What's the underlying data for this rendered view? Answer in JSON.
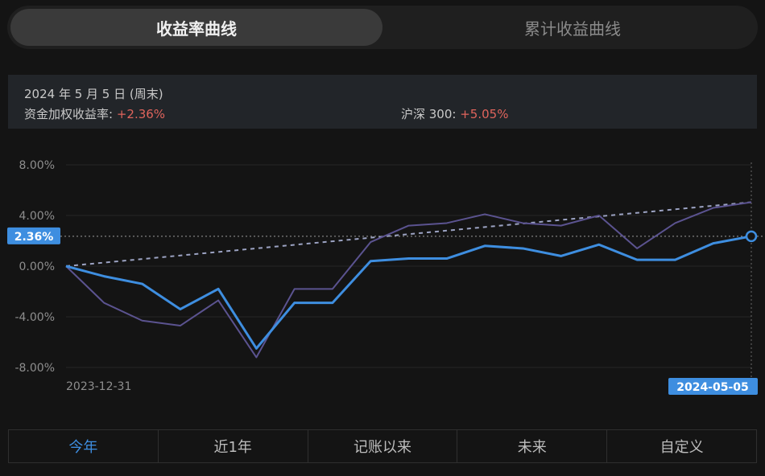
{
  "tabs": [
    {
      "label": "收益率曲线",
      "active": true
    },
    {
      "label": "累计收益曲线",
      "active": false
    }
  ],
  "info": {
    "date": "2024 年 5 月 5 日 (周末)",
    "fund_label": "资金加权收益率:",
    "fund_value": "+2.36%",
    "index_label": "沪深 300:",
    "index_value": "+5.05%"
  },
  "colors": {
    "primary": "#3e8ee0",
    "secondary": "#5b5390",
    "positive": "#e0645c"
  },
  "chart_data": {
    "type": "line",
    "x": [
      "2023-12-31",
      "2024-01-07",
      "2024-01-14",
      "2024-01-21",
      "2024-01-28",
      "2024-02-04",
      "2024-02-11",
      "2024-02-18",
      "2024-02-25",
      "2024-03-03",
      "2024-03-10",
      "2024-03-17",
      "2024-03-24",
      "2024-03-31",
      "2024-04-07",
      "2024-04-14",
      "2024-04-21",
      "2024-04-28",
      "2024-05-05"
    ],
    "series": [
      {
        "name": "资金加权收益率",
        "values": [
          0.0,
          -0.8,
          -1.4,
          -3.4,
          -1.8,
          -6.5,
          -2.9,
          -2.9,
          0.4,
          0.6,
          0.6,
          1.6,
          1.4,
          0.8,
          1.7,
          0.5,
          0.5,
          1.8,
          2.36
        ],
        "color": "#3e8ee0"
      },
      {
        "name": "沪深 300",
        "values": [
          0.0,
          -2.9,
          -4.3,
          -4.7,
          -2.7,
          -7.2,
          -1.8,
          -1.8,
          1.9,
          3.2,
          3.4,
          4.1,
          3.4,
          3.2,
          4.0,
          1.4,
          3.4,
          4.6,
          5.05
        ],
        "color": "#5b5390"
      }
    ],
    "trend": {
      "from": 0.0,
      "to": 5.05
    },
    "yticks": [
      "8.00%",
      "4.00%",
      "0.00%",
      "-4.00%",
      "-8.00%"
    ],
    "ytick_values": [
      8,
      4,
      0,
      -4,
      -8
    ],
    "ylim": [
      -8,
      8
    ],
    "x_start_label": "2023-12-31",
    "x_end_label": "2024-05-05",
    "current_value_label": "2.36%",
    "current_value": 2.36,
    "grid": true
  },
  "ranges": [
    {
      "label": "今年",
      "selected": true
    },
    {
      "label": "近1年",
      "selected": false
    },
    {
      "label": "记账以来",
      "selected": false
    },
    {
      "label": "未来",
      "selected": false
    },
    {
      "label": "自定义",
      "selected": false
    }
  ]
}
